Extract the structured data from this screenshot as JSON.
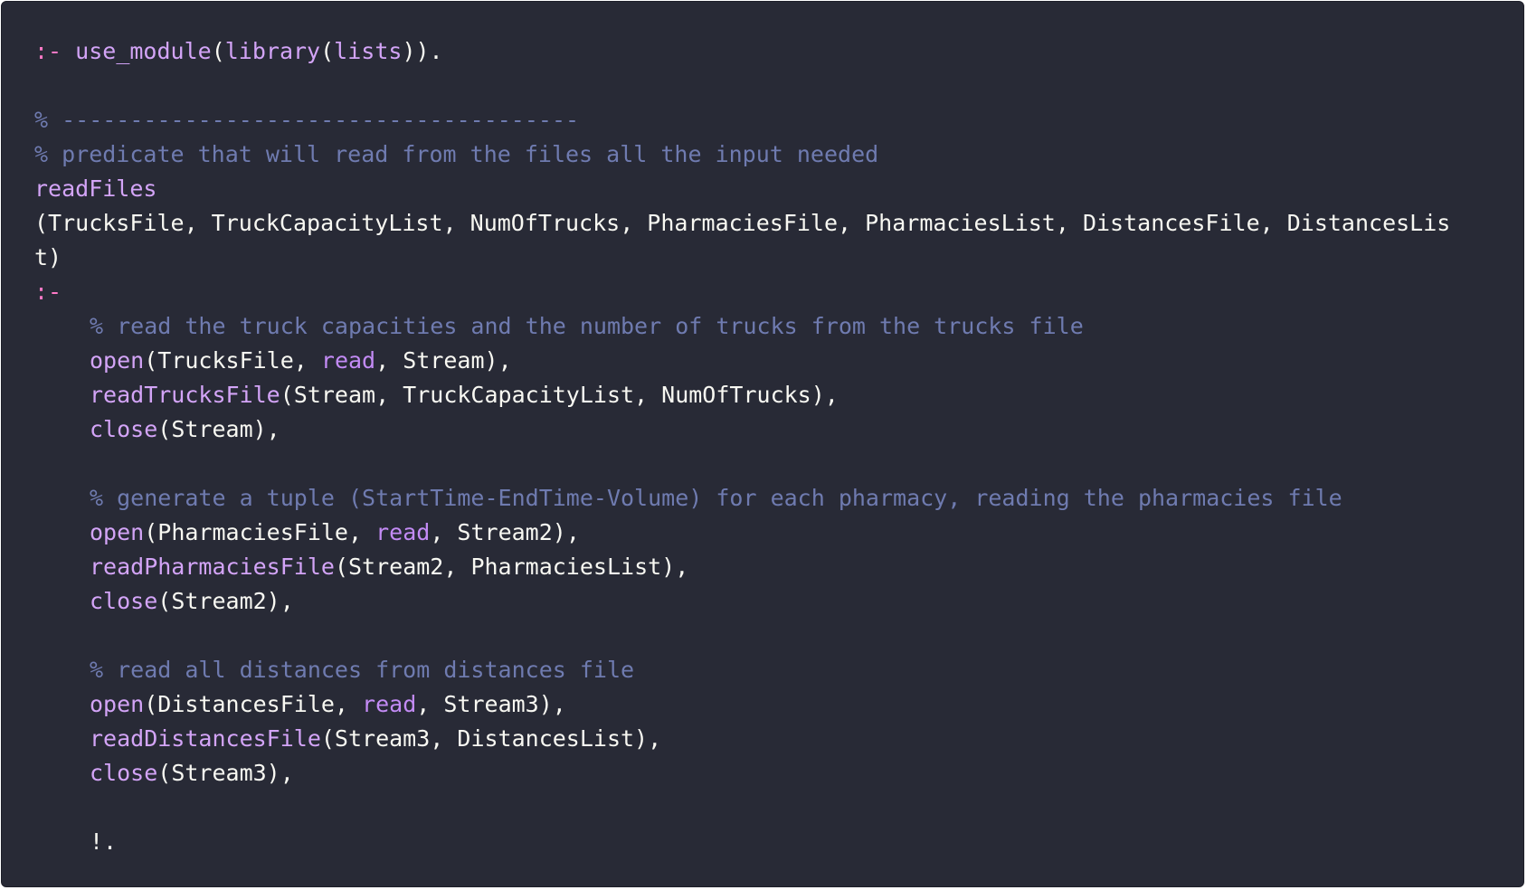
{
  "colors": {
    "background": "#282a36",
    "text": "#f8f8f2",
    "keyword": "#ff79c6",
    "function": "#d3a4f7",
    "comment": "#6f7bb0"
  },
  "code": {
    "language": "prolog",
    "lines": [
      [
        {
          "t": "keyword",
          "v": ":-"
        },
        {
          "t": "punct",
          "v": " "
        },
        {
          "t": "func",
          "v": "use_module"
        },
        {
          "t": "punct",
          "v": "("
        },
        {
          "t": "func",
          "v": "library"
        },
        {
          "t": "punct",
          "v": "("
        },
        {
          "t": "func",
          "v": "lists"
        },
        {
          "t": "punct",
          "v": "))."
        }
      ],
      [],
      [
        {
          "t": "comment",
          "v": "% --------------------------------------"
        }
      ],
      [
        {
          "t": "comment",
          "v": "% predicate that will read from the files all the input needed"
        }
      ],
      [
        {
          "t": "func",
          "v": "readFiles"
        }
      ],
      [
        {
          "t": "punct",
          "v": "(TrucksFile, TruckCapacityList, NumOfTrucks, PharmaciesFile, PharmaciesList, DistancesFile, DistancesLis"
        }
      ],
      [
        {
          "t": "punct",
          "v": "t)"
        }
      ],
      [
        {
          "t": "keyword",
          "v": ":-"
        }
      ],
      [
        {
          "t": "indent"
        },
        {
          "t": "comment",
          "v": "% read the truck capacities and the number of trucks from the trucks file"
        }
      ],
      [
        {
          "t": "indent"
        },
        {
          "t": "func",
          "v": "open"
        },
        {
          "t": "punct",
          "v": "(TrucksFile, "
        },
        {
          "t": "atom",
          "v": "read"
        },
        {
          "t": "punct",
          "v": ", Stream),"
        }
      ],
      [
        {
          "t": "indent"
        },
        {
          "t": "func",
          "v": "readTrucksFile"
        },
        {
          "t": "punct",
          "v": "(Stream, TruckCapacityList, NumOfTrucks),"
        }
      ],
      [
        {
          "t": "indent"
        },
        {
          "t": "func",
          "v": "close"
        },
        {
          "t": "punct",
          "v": "(Stream),"
        }
      ],
      [],
      [
        {
          "t": "indent"
        },
        {
          "t": "comment",
          "v": "% generate a tuple (StartTime-EndTime-Volume) for each pharmacy, reading the pharmacies file"
        }
      ],
      [
        {
          "t": "indent"
        },
        {
          "t": "func",
          "v": "open"
        },
        {
          "t": "punct",
          "v": "(PharmaciesFile, "
        },
        {
          "t": "atom",
          "v": "read"
        },
        {
          "t": "punct",
          "v": ", Stream2),"
        }
      ],
      [
        {
          "t": "indent"
        },
        {
          "t": "func",
          "v": "readPharmaciesFile"
        },
        {
          "t": "punct",
          "v": "(Stream2, PharmaciesList),"
        }
      ],
      [
        {
          "t": "indent"
        },
        {
          "t": "func",
          "v": "close"
        },
        {
          "t": "punct",
          "v": "(Stream2),"
        }
      ],
      [],
      [
        {
          "t": "indent"
        },
        {
          "t": "comment",
          "v": "% read all distances from distances file"
        }
      ],
      [
        {
          "t": "indent"
        },
        {
          "t": "func",
          "v": "open"
        },
        {
          "t": "punct",
          "v": "(DistancesFile, "
        },
        {
          "t": "atom",
          "v": "read"
        },
        {
          "t": "punct",
          "v": ", Stream3),"
        }
      ],
      [
        {
          "t": "indent"
        },
        {
          "t": "func",
          "v": "readDistancesFile"
        },
        {
          "t": "punct",
          "v": "(Stream3, DistancesList),"
        }
      ],
      [
        {
          "t": "indent"
        },
        {
          "t": "func",
          "v": "close"
        },
        {
          "t": "punct",
          "v": "(Stream3),"
        }
      ],
      [],
      [
        {
          "t": "indent"
        },
        {
          "t": "punct",
          "v": "!."
        }
      ]
    ]
  }
}
